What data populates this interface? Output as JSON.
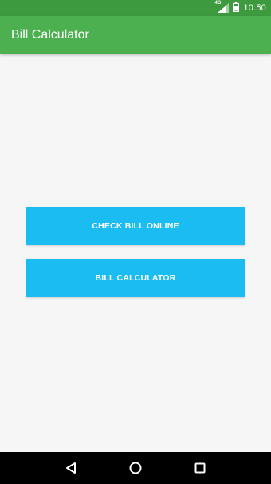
{
  "status_bar": {
    "network_type": "4G",
    "time": "10:50",
    "icons": [
      "signal-icon",
      "battery-icon"
    ],
    "color": "#3d9a3f"
  },
  "app_bar": {
    "title": "Bill Calculator",
    "color": "#4caf50"
  },
  "main": {
    "buttons": [
      {
        "label": "CHECK BILL ONLINE"
      },
      {
        "label": "BILL CALCULATOR"
      }
    ],
    "button_color": "#1bbcf2"
  },
  "nav_bar": {
    "icons": [
      "back-icon",
      "home-icon",
      "recents-icon"
    ]
  }
}
